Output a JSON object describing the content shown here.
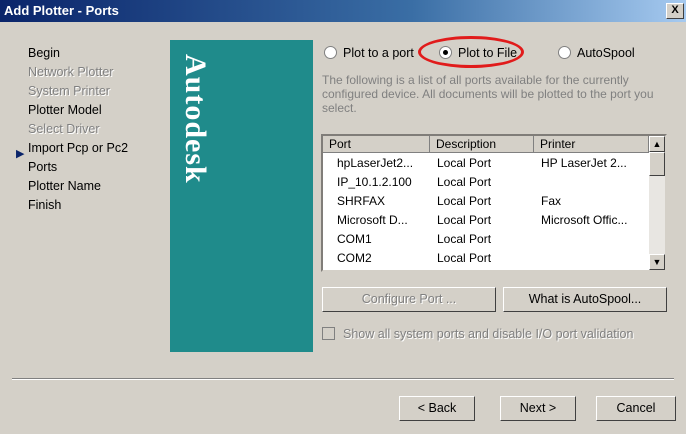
{
  "window": {
    "title": "Add Plotter - Ports",
    "close_label": "X"
  },
  "steps": [
    {
      "label": "Begin",
      "state": "normal"
    },
    {
      "label": "Network Plotter",
      "state": "disabled"
    },
    {
      "label": "System Printer",
      "state": "disabled"
    },
    {
      "label": "Plotter Model",
      "state": "normal"
    },
    {
      "label": "Select Driver",
      "state": "disabled"
    },
    {
      "label": "Import Pcp or Pc2",
      "state": "normal"
    },
    {
      "label": "Ports",
      "state": "current"
    },
    {
      "label": "Plotter Name",
      "state": "normal"
    },
    {
      "label": "Finish",
      "state": "normal"
    }
  ],
  "brand": {
    "text": "Autodesk"
  },
  "radios": {
    "plot_to_port": "Plot to a port",
    "plot_to_file": "Plot to File",
    "autospool": "AutoSpool",
    "selected": "plot_to_file"
  },
  "description": "The following is a list of all ports available for the currently configured device. All documents will be plotted to the port you select.",
  "ports_table": {
    "headers": [
      "Port",
      "Description",
      "Printer"
    ],
    "rows": [
      [
        "hpLaserJet2...",
        "Local Port",
        "HP LaserJet 2..."
      ],
      [
        "IP_10.1.2.100",
        "Local Port",
        ""
      ],
      [
        "SHRFAX",
        "Local Port",
        "Fax"
      ],
      [
        "Microsoft D...",
        "Local Port",
        "Microsoft Offic..."
      ],
      [
        "COM1",
        "Local Port",
        ""
      ],
      [
        "COM2",
        "Local Port",
        ""
      ]
    ]
  },
  "buttons": {
    "configure_port": "Configure Port ...",
    "what_is_autospool": "What is AutoSpool...",
    "back": "< Back",
    "next": "Next >",
    "cancel": "Cancel"
  },
  "checkbox": {
    "label": "Show all system ports and disable I/O port validation",
    "checked": false
  },
  "colors": {
    "title_bar": "#0a246a",
    "brand_panel": "#1f8b8b",
    "highlight_circle": "#e11b1b",
    "dialog_face": "#d4d0c8"
  }
}
